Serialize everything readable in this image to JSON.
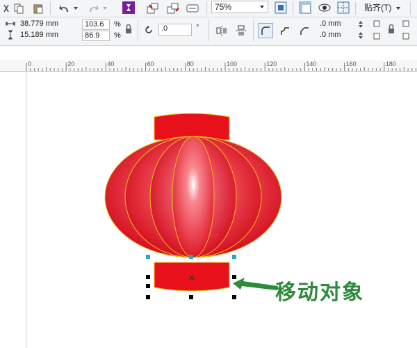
{
  "toolbar": {
    "zoom_value": "75%",
    "snap_label": "贴齐(T)"
  },
  "properties": {
    "width": "38.779 mm",
    "height": "15.189 mm",
    "scale_x": "103.6",
    "scale_y": "86.9",
    "percent_symbol": "%",
    "rotation": ".0",
    "degree_symbol": "°",
    "corner_radius_top": ".0 mm",
    "corner_radius_bottom": ".0 mm"
  },
  "ruler": {
    "ticks": [
      "0",
      "20",
      "40",
      "60",
      "80",
      "100",
      "120",
      "140",
      "160",
      "180"
    ]
  },
  "annotation": {
    "text": "移动对象"
  },
  "colors": {
    "lantern_red": "#e8101a",
    "lantern_outline": "#e8c020",
    "selection_handle": "#000000",
    "node_handle": "#2aa8c8",
    "annotation_green": "#2e8b3a"
  }
}
